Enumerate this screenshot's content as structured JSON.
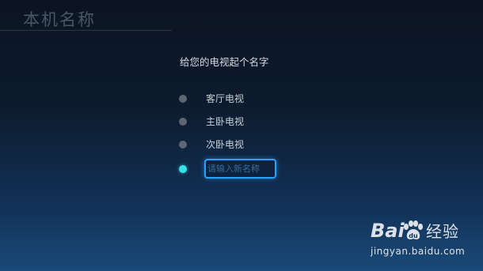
{
  "page": {
    "title": "本机名称",
    "prompt": "给您的电视起个名字"
  },
  "options": [
    {
      "label": "客厅电视",
      "selected": false
    },
    {
      "label": "主卧电视",
      "selected": false
    },
    {
      "label": "次卧电视",
      "selected": false
    }
  ],
  "custom_name": {
    "value": "",
    "placeholder": "请输入新名称",
    "selected": true
  },
  "colors": {
    "accent": "#35e0e8",
    "focus_border": "#2aa0ff",
    "radio_inactive": "#5d6774"
  },
  "watermark": {
    "brand": "Bai",
    "brand_suffix": "经验",
    "url": "jingyan.baidu.com",
    "icon": "paw-icon"
  }
}
